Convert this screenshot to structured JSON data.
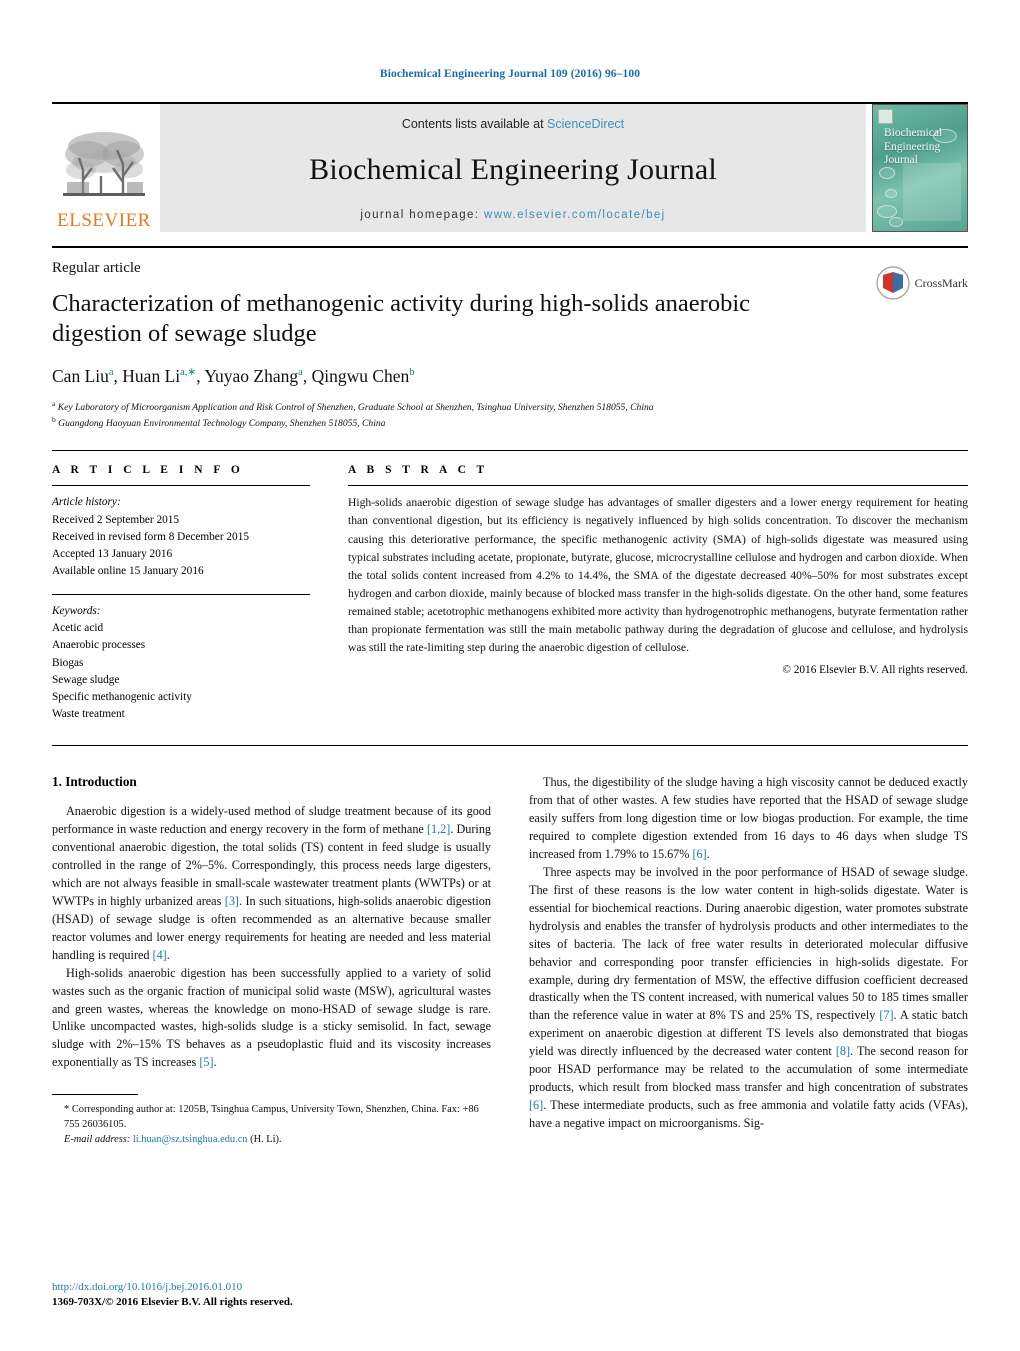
{
  "running_head": "Biochemical Engineering Journal 109 (2016) 96–100",
  "masthead": {
    "elsevier_wordmark": "ELSEVIER",
    "contents_prefix": "Contents lists available at ",
    "contents_link": "ScienceDirect",
    "journal_name": "Biochemical Engineering Journal",
    "homepage_prefix": "journal homepage: ",
    "homepage_url": "www.elsevier.com/locate/bej",
    "cover_title_line1": "Biochemical",
    "cover_title_line2": "Engineering",
    "cover_title_line3": "Journal",
    "accent_color": "#3a8fbf",
    "elsevier_orange": "#E87722"
  },
  "title_block": {
    "kicker": "Regular article",
    "title": "Characterization of methanogenic activity during high-solids anaerobic digestion of sewage sludge",
    "authors_html": "Can Liu<sup>a</sup>, Huan Li<sup>a,∗</sup>, Yuyao Zhang<sup>a</sup>, Qingwu Chen<sup>b</sup>",
    "affiliation_a": "Key Laboratory of Microorganism Application and Risk Control of Shenzhen, Graduate School at Shenzhen, Tsinghua University, Shenzhen 518055, China",
    "affiliation_b": "Guangdong Haoyuan Environmental Technology Company, Shenzhen 518055, China",
    "crossmark_label": "CrossMark"
  },
  "article_info": {
    "heading": "A R T I C L E   I N F O",
    "history_label": "Article history:",
    "history": [
      "Received 2 September 2015",
      "Received in revised form 8 December 2015",
      "Accepted 13 January 2016",
      "Available online 15 January 2016"
    ],
    "keywords_label": "Keywords:",
    "keywords": [
      "Acetic acid",
      "Anaerobic processes",
      "Biogas",
      "Sewage sludge",
      "Specific methanogenic activity",
      "Waste treatment"
    ]
  },
  "abstract": {
    "heading": "A B S T R A C T",
    "text": "High-solids anaerobic digestion of sewage sludge has advantages of smaller digesters and a lower energy requirement for heating than conventional digestion, but its efficiency is negatively influenced by high solids concentration. To discover the mechanism causing this deteriorative performance, the specific methanogenic activity (SMA) of high-solids digestate was measured using typical substrates including acetate, propionate, butyrate, glucose, microcrystalline cellulose and hydrogen and carbon dioxide. When the total solids content increased from 4.2% to 14.4%, the SMA of the digestate decreased 40%–50% for most substrates except hydrogen and carbon dioxide, mainly because of blocked mass transfer in the high-solids digestate. On the other hand, some features remained stable; acetotrophic methanogens exhibited more activity than hydrogenotrophic methanogens, butyrate fermentation rather than propionate fermentation was still the main metabolic pathway during the degradation of glucose and cellulose, and hydrolysis was still the rate-limiting step during the anaerobic digestion of cellulose.",
    "copyright": "© 2016 Elsevier B.V. All rights reserved."
  },
  "introduction": {
    "section_title": "1.  Introduction",
    "left_paragraphs": [
      {
        "segments": [
          {
            "t": "Anaerobic digestion is a widely-used method of sludge treatment because of its good performance in waste reduction and energy recovery in the form of methane "
          },
          {
            "t": "[1,2]",
            "ref": true
          },
          {
            "t": ". During conventional anaerobic digestion, the total solids (TS) content in feed sludge is usually controlled in the range of 2%–5%. Correspondingly, this process needs large digesters, which are not always feasible in small-scale wastewater treatment plants (WWTPs) or at WWTPs in highly urbanized areas "
          },
          {
            "t": "[3]",
            "ref": true
          },
          {
            "t": ". In such situations, high-solids anaerobic digestion (HSAD) of sewage sludge is often recommended as an alternative because smaller reactor volumes and lower energy requirements for heating are needed and less material handling is required "
          },
          {
            "t": "[4]",
            "ref": true
          },
          {
            "t": "."
          }
        ]
      },
      {
        "segments": [
          {
            "t": "High-solids anaerobic digestion has been successfully applied to a variety of solid wastes such as the organic fraction of municipal solid waste (MSW), agricultural wastes and green wastes, whereas the knowledge on mono-HSAD of sewage sludge is rare. Unlike uncompacted wastes, high-solids sludge is a sticky semisolid. In fact, sewage sludge with 2%–15% TS behaves as a pseudoplastic fluid and its viscosity increases exponentially as TS increases "
          },
          {
            "t": "[5]",
            "ref": true
          },
          {
            "t": "."
          }
        ]
      }
    ],
    "right_paragraphs": [
      {
        "segments": [
          {
            "t": "Thus, the digestibility of the sludge having a high viscosity cannot be deduced exactly from that of other wastes. A few studies have reported that the HSAD of sewage sludge easily suffers from long digestion time or low biogas production. For example, the time required to complete digestion extended from 16 days to 46 days when sludge TS increased from 1.79% to 15.67% "
          },
          {
            "t": "[6]",
            "ref": true
          },
          {
            "t": "."
          }
        ],
        "no_indent": false
      },
      {
        "segments": [
          {
            "t": "Three aspects may be involved in the poor performance of HSAD of sewage sludge. The first of these reasons is the low water content in high-solids digestate. Water is essential for biochemical reactions. During anaerobic digestion, water promotes substrate hydrolysis and enables the transfer of hydrolysis products and other intermediates to the sites of bacteria. The lack of free water results in deteriorated molecular diffusive behavior and corresponding poor transfer efficiencies in high-solids digestate. For example, during dry fermentation of MSW, the effective diffusion coefficient decreased drastically when the TS content increased, with numerical values 50 to 185 times smaller than the reference value in water at 8% TS and 25% TS, respectively "
          },
          {
            "t": "[7]",
            "ref": true
          },
          {
            "t": ". A static batch experiment on anaerobic digestion at different TS levels also demonstrated that biogas yield was directly influenced by the decreased water content "
          },
          {
            "t": "[8]",
            "ref": true
          },
          {
            "t": ". The second reason for poor HSAD performance may be related to the accumulation of some intermediate products, which result from blocked mass transfer and high concentration of substrates "
          },
          {
            "t": "[6]",
            "ref": true
          },
          {
            "t": ". These intermediate products, such as free ammonia and volatile fatty acids (VFAs), have a negative impact on microorganisms. Sig-"
          }
        ]
      }
    ]
  },
  "footnote": {
    "marker": "*",
    "corresponding": "Corresponding author at: 1205B, Tsinghua Campus, University Town, Shenzhen, China. Fax: +86 755 26036105.",
    "email_label": "E-mail address:",
    "email": "li.huan@sz.tsinghua.edu.cn",
    "email_suffix": "(H. Li)."
  },
  "footer": {
    "doi": "http://dx.doi.org/10.1016/j.bej.2016.01.010",
    "issn_line": "1369-703X/© 2016 Elsevier B.V. All rights reserved."
  }
}
